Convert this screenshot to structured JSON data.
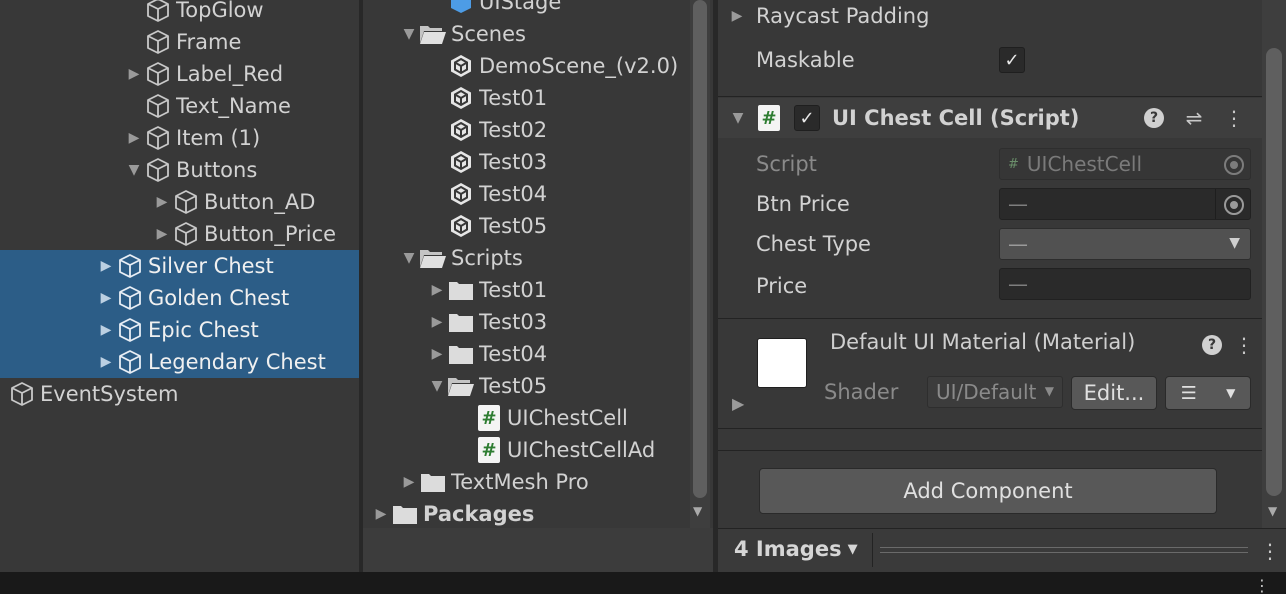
{
  "hierarchy": {
    "items": [
      {
        "label": "TopGlow",
        "depth": 2,
        "arrow": "",
        "selected": false
      },
      {
        "label": "Frame",
        "depth": 2,
        "arrow": "",
        "selected": false
      },
      {
        "label": "Label_Red",
        "depth": 2,
        "arrow": "▶",
        "selected": false
      },
      {
        "label": "Text_Name",
        "depth": 2,
        "arrow": "",
        "selected": false
      },
      {
        "label": "Item (1)",
        "depth": 2,
        "arrow": "▶",
        "selected": false
      },
      {
        "label": "Buttons",
        "depth": 2,
        "arrow": "▼",
        "selected": false
      },
      {
        "label": "Button_AD",
        "depth": 3,
        "arrow": "▶",
        "selected": false
      },
      {
        "label": "Button_Price",
        "depth": 3,
        "arrow": "▶",
        "selected": false
      },
      {
        "label": "Silver Chest",
        "depth": 1,
        "arrow": "▶",
        "selected": true
      },
      {
        "label": "Golden Chest",
        "depth": 1,
        "arrow": "▶",
        "selected": true
      },
      {
        "label": "Epic Chest",
        "depth": 1,
        "arrow": "▶",
        "selected": true
      },
      {
        "label": "Legendary Chest",
        "depth": 1,
        "arrow": "▶",
        "selected": true
      },
      {
        "label": "EventSystem",
        "depth": 0,
        "arrow": "",
        "selected": false
      }
    ]
  },
  "project": {
    "items": [
      {
        "label": "UIStage",
        "depth": 2,
        "arrow": "",
        "icon": "prefab-icon",
        "bold": false
      },
      {
        "label": "Scenes",
        "depth": 1,
        "arrow": "▼",
        "icon": "folder-open-icon",
        "bold": false
      },
      {
        "label": "DemoScene_(v2.0)",
        "depth": 2,
        "arrow": "",
        "icon": "unity-scene-icon",
        "bold": false
      },
      {
        "label": "Test01",
        "depth": 2,
        "arrow": "",
        "icon": "unity-scene-icon",
        "bold": false
      },
      {
        "label": "Test02",
        "depth": 2,
        "arrow": "",
        "icon": "unity-scene-icon",
        "bold": false
      },
      {
        "label": "Test03",
        "depth": 2,
        "arrow": "",
        "icon": "unity-scene-icon",
        "bold": false
      },
      {
        "label": "Test04",
        "depth": 2,
        "arrow": "",
        "icon": "unity-scene-icon",
        "bold": false
      },
      {
        "label": "Test05",
        "depth": 2,
        "arrow": "",
        "icon": "unity-scene-icon",
        "bold": false
      },
      {
        "label": "Scripts",
        "depth": 1,
        "arrow": "▼",
        "icon": "folder-open-icon",
        "bold": false
      },
      {
        "label": "Test01",
        "depth": 2,
        "arrow": "▶",
        "icon": "folder-icon",
        "bold": false
      },
      {
        "label": "Test03",
        "depth": 2,
        "arrow": "▶",
        "icon": "folder-icon",
        "bold": false
      },
      {
        "label": "Test04",
        "depth": 2,
        "arrow": "▶",
        "icon": "folder-icon",
        "bold": false
      },
      {
        "label": "Test05",
        "depth": 2,
        "arrow": "▼",
        "icon": "folder-open-icon",
        "bold": false
      },
      {
        "label": "UIChestCell",
        "depth": 3,
        "arrow": "",
        "icon": "csharp-script-icon",
        "bold": false
      },
      {
        "label": "UIChestCellAd",
        "depth": 3,
        "arrow": "",
        "icon": "csharp-script-icon",
        "bold": false
      },
      {
        "label": "TextMesh Pro",
        "depth": 1,
        "arrow": "▶",
        "icon": "folder-icon",
        "bold": false
      },
      {
        "label": "Packages",
        "depth": 0,
        "arrow": "▶",
        "icon": "folder-icon",
        "bold": true
      }
    ]
  },
  "inspector": {
    "raycast_padding_label": "Raycast Padding",
    "maskable_label": "Maskable",
    "maskable_check": "✓",
    "component_title": "UI Chest Cell (Script)",
    "component_enabled_check": "✓",
    "help_glyph": "?",
    "presets_glyph": "⇌",
    "more_glyph": "⋮",
    "fields": {
      "script_label": "Script",
      "script_value": "UIChestCell",
      "btn_price_label": "Btn Price",
      "btn_price_value": "—",
      "chest_type_label": "Chest Type",
      "chest_type_value": "—",
      "price_label": "Price",
      "price_value": "—"
    },
    "material": {
      "title": "Default UI Material (Material)",
      "shader_label": "Shader",
      "shader_value": "UI/Default",
      "edit_label": "Edit..."
    },
    "add_component_label": "Add Component",
    "preview_label": "4 Images"
  },
  "colors": {
    "panel_bg": "#383838",
    "selection": "#2c5d87",
    "status_bar": "#191919",
    "script_hash": "#2e7d32"
  }
}
